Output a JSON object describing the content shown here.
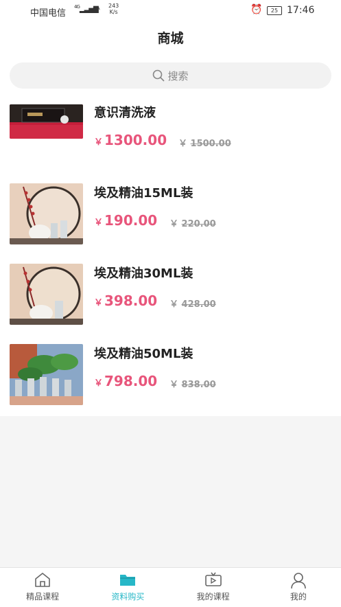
{
  "status_bar": {
    "carrier": "中国电信",
    "network": "4G",
    "speed_value": "243",
    "speed_unit": "K/s",
    "battery": "25",
    "time": "17:46"
  },
  "header": {
    "title": "商城"
  },
  "search": {
    "placeholder": "搜索"
  },
  "products": [
    {
      "name": "意识清洗液",
      "currency": "￥",
      "price": "1300.00",
      "original_price": "1500.00"
    },
    {
      "name": "埃及精油15ML装",
      "currency": "￥",
      "price": "190.00",
      "original_price": "220.00"
    },
    {
      "name": "埃及精油30ML装",
      "currency": "￥",
      "price": "398.00",
      "original_price": "428.00"
    },
    {
      "name": "埃及精油50ML装",
      "currency": "￥",
      "price": "798.00",
      "original_price": "838.00"
    }
  ],
  "tabs": [
    {
      "label": "精品课程",
      "icon": "home-icon",
      "active": false
    },
    {
      "label": "资料购买",
      "icon": "folder-icon",
      "active": true
    },
    {
      "label": "我的课程",
      "icon": "video-icon",
      "active": false
    },
    {
      "label": "我的",
      "icon": "user-icon",
      "active": false
    }
  ],
  "colors": {
    "accent": "#26b7c7",
    "price": "#e8557b",
    "original_price": "#999999"
  }
}
